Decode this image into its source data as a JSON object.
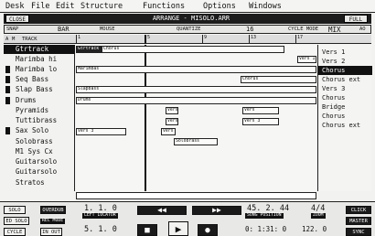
{
  "menu": [
    "Desk",
    "File",
    "Edit",
    "Structure",
    "Functions",
    "Options",
    "Windows"
  ],
  "window": {
    "title": "ARRANGE - MISOLO.ARR",
    "close": "CLOSE",
    "full": "FULL"
  },
  "subbar": {
    "snap_label": "SNAP",
    "snap_value": "BAR",
    "mouse_label": "MOUSE",
    "quantize_label": "QUANTIZE",
    "quantize_value": "16",
    "cycle_mode_label": "CYCLE MODE",
    "cycle_mode_value": "MIX",
    "extra": "AO"
  },
  "header": {
    "a": "A",
    "m": "M",
    "track": "TRACK"
  },
  "ruler": [
    "1",
    "5",
    "9",
    "13",
    "17"
  ],
  "tracks": [
    "Gtrtrack",
    "Marimba hi",
    "Marimba lo",
    "Seq Bass",
    "Slap Bass",
    "Drums",
    "Pyramids",
    "Tuttibrass",
    "Sax Solo",
    "Solobrass",
    "M1 Sys Cx",
    "Guitarsolo",
    "Guitarsolo",
    "Stratos"
  ],
  "segments": [
    "Gtrtrack",
    "Chorus",
    "Vers 1",
    "Marimbas",
    "Chorus",
    "Slapbass",
    "Drums",
    "Vers",
    "Vers",
    "Vers",
    "Vers 3",
    "Vers",
    "Vers 3",
    "Solobrass"
  ],
  "parts": [
    "Vers 1",
    "Vers 2",
    "Chorus",
    "Chorus ext",
    "Vers 3",
    "Chorus",
    "Bridge",
    "Chorus",
    "Chorus ext"
  ],
  "transport": {
    "solo": "SOLO",
    "overdub": "OVERDUB",
    "left_locator_value": "1. 1. 0",
    "left_locator_label": "LEFT LOCATOR",
    "song_position_value": "45. 2. 44",
    "song_position_label": "SONG POSITION",
    "signature": "4/4",
    "zoom": "ZOOM",
    "click": "CLICK",
    "ed_solo": "ED SOLO",
    "rec_mode": "REC MODE",
    "master": "MASTER",
    "cycle": "CYCLE",
    "in_out": "IN OUT",
    "right_locator_value": "5. 1. 0",
    "right_locator_label": "RIGHT LOCATOR",
    "time_value": "0: 1:31: 0",
    "tempo_value": "122. 0",
    "sync": "SYNC",
    "rew": "◀◀",
    "ff": "▶▶",
    "stop": "■",
    "play": "▶",
    "rec": "●"
  }
}
